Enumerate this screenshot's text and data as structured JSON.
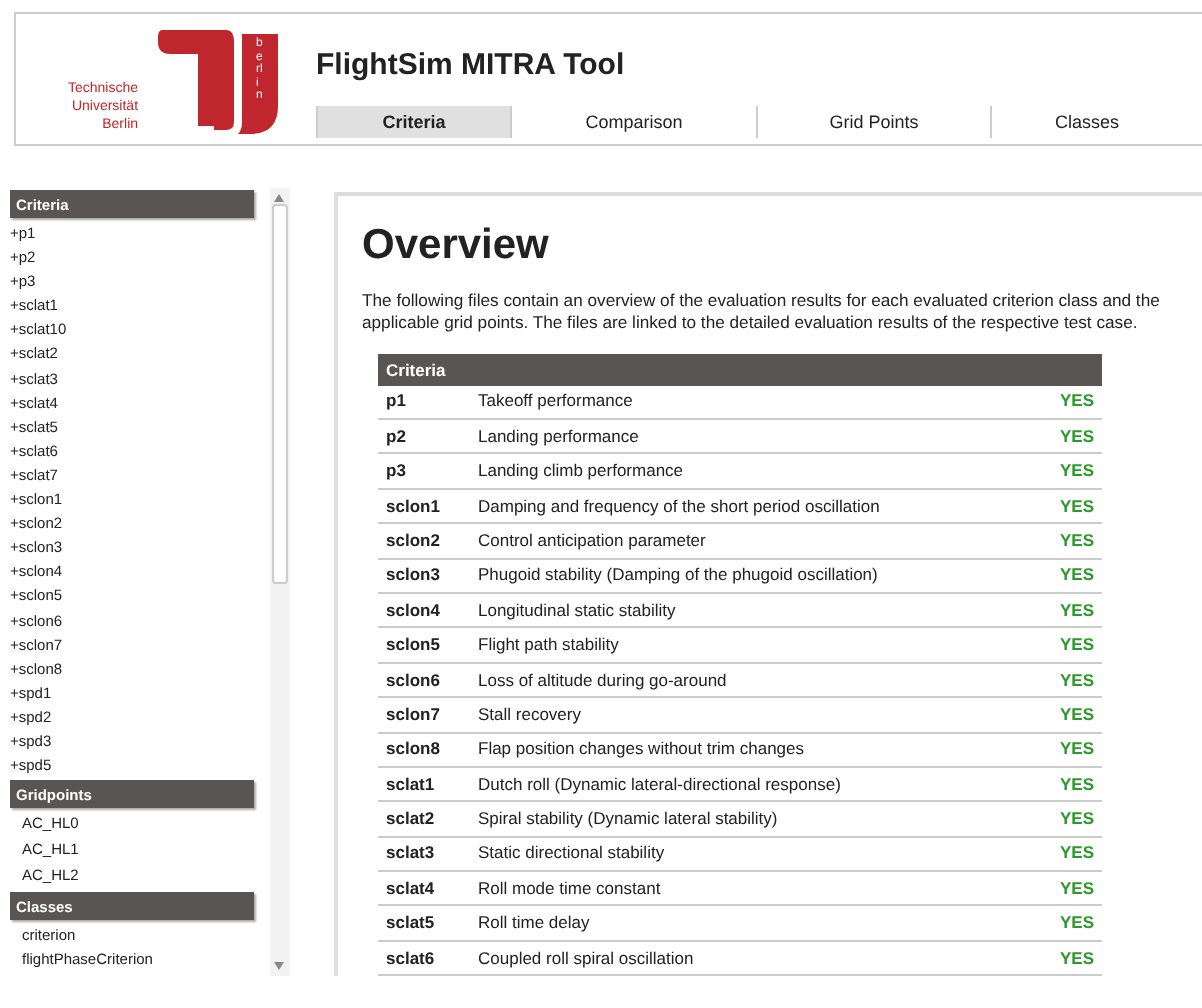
{
  "logo": {
    "lines": [
      "Technische",
      "Universität",
      "Berlin"
    ],
    "vertical": "berlin"
  },
  "title": "FlightSim MITRA Tool",
  "tabs": [
    {
      "label": "Criteria",
      "selected": true
    },
    {
      "label": "Comparison",
      "selected": false
    },
    {
      "label": "Grid Points",
      "selected": false
    },
    {
      "label": "Classes",
      "selected": false
    }
  ],
  "sidebar": [
    {
      "heading": "Criteria",
      "kind": "plus",
      "items": [
        "+p1",
        "+p2",
        "+p3",
        "+sclat1",
        "+sclat10",
        "+sclat2",
        "+sclat3",
        "+sclat4",
        "+sclat5",
        "+sclat6",
        "+sclat7",
        "+sclon1",
        "+sclon2",
        "+sclon3",
        "+sclon4",
        "+sclon5",
        "+sclon6",
        "+sclon7",
        "+sclon8",
        "+spd1",
        "+spd2",
        "+spd3",
        "+spd5"
      ]
    },
    {
      "heading": "Gridpoints",
      "kind": "indented",
      "items": [
        "AC_HL0",
        "AC_HL1",
        "AC_HL2"
      ]
    },
    {
      "heading": "Classes",
      "kind": "indented",
      "items": [
        "criterion",
        "flightPhaseCriterion"
      ]
    }
  ],
  "main": {
    "heading": "Overview",
    "intro": "The following files contain an overview of the evaluation results for each evaluated criterion class and the applicable grid points. The files are linked to the detailed evaluation results of the respective test case.",
    "table": {
      "header": "Criteria",
      "rows": [
        {
          "id": "p1",
          "name": "Takeoff performance",
          "result": "YES"
        },
        {
          "id": "p2",
          "name": "Landing performance",
          "result": "YES"
        },
        {
          "id": "p3",
          "name": "Landing climb performance",
          "result": "YES"
        },
        {
          "id": "sclon1",
          "name": "Damping and frequency of the short period oscillation",
          "result": "YES"
        },
        {
          "id": "sclon2",
          "name": "Control anticipation parameter",
          "result": "YES"
        },
        {
          "id": "sclon3",
          "name": "Phugoid stability (Damping of the phugoid oscillation)",
          "result": "YES"
        },
        {
          "id": "sclon4",
          "name": "Longitudinal static stability",
          "result": "YES"
        },
        {
          "id": "sclon5",
          "name": "Flight path stability",
          "result": "YES"
        },
        {
          "id": "sclon6",
          "name": "Loss of altitude during go-around",
          "result": "YES"
        },
        {
          "id": "sclon7",
          "name": "Stall recovery",
          "result": "YES"
        },
        {
          "id": "sclon8",
          "name": "Flap position changes without trim changes",
          "result": "YES"
        },
        {
          "id": "sclat1",
          "name": "Dutch roll (Dynamic lateral-directional response)",
          "result": "YES"
        },
        {
          "id": "sclat2",
          "name": "Spiral stability (Dynamic lateral stability)",
          "result": "YES"
        },
        {
          "id": "sclat3",
          "name": "Static directional stability",
          "result": "YES"
        },
        {
          "id": "sclat4",
          "name": "Roll mode time constant",
          "result": "YES"
        },
        {
          "id": "sclat5",
          "name": "Roll time delay",
          "result": "YES"
        },
        {
          "id": "sclat6",
          "name": "Coupled roll spiral oscillation",
          "result": "YES"
        }
      ]
    }
  }
}
